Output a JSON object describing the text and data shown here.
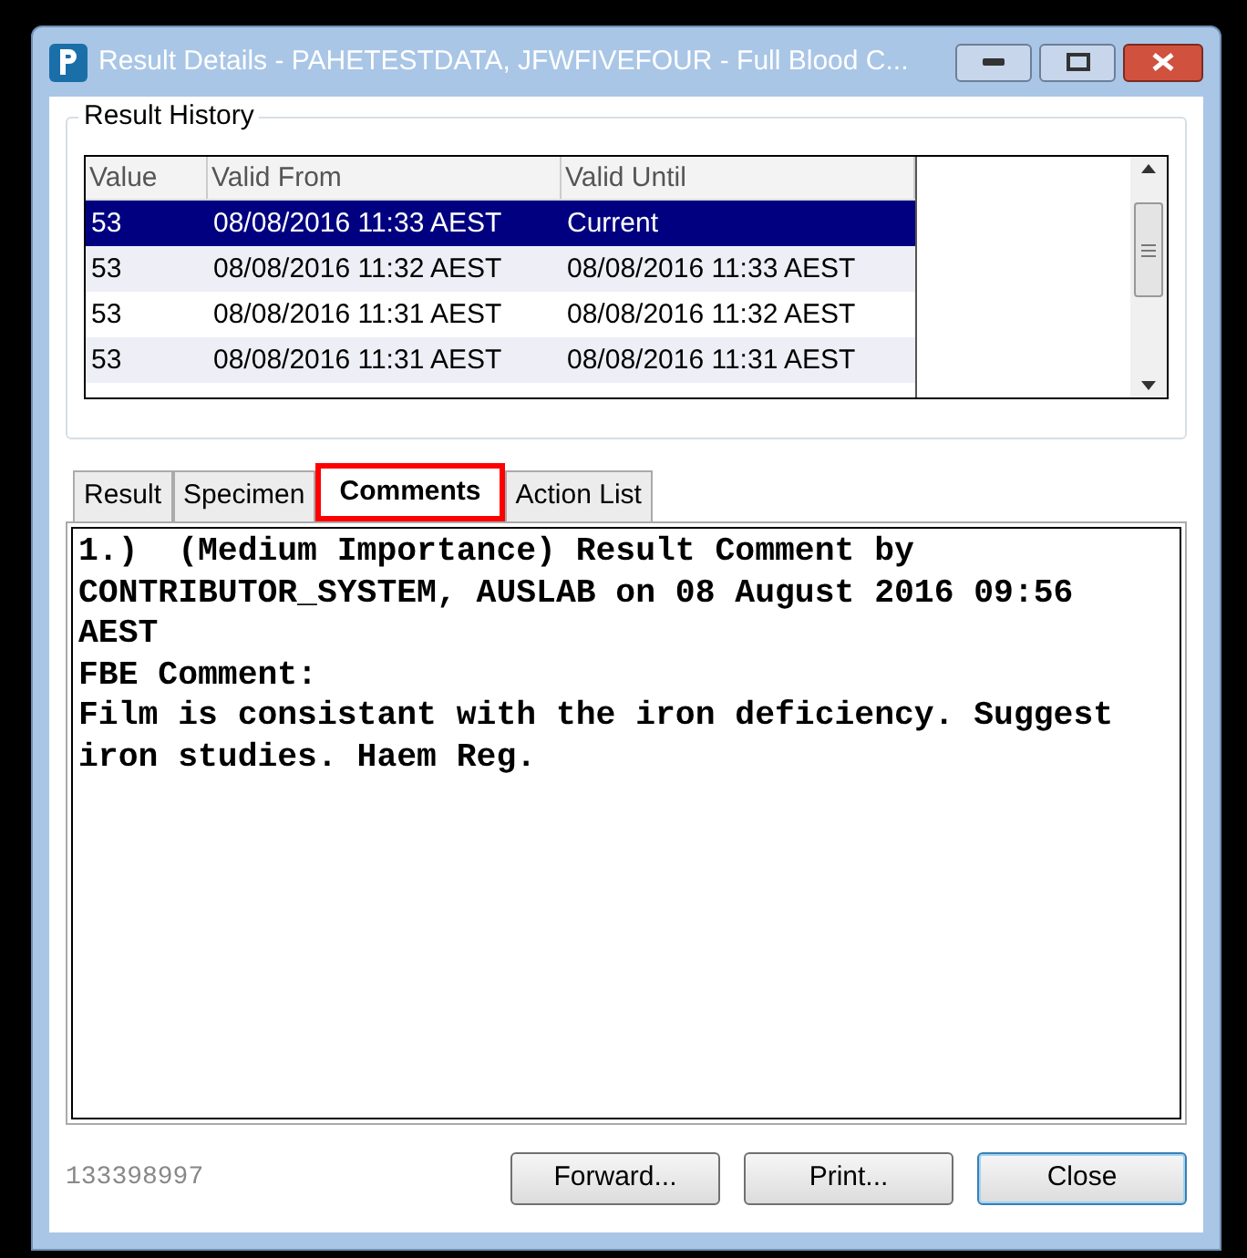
{
  "window": {
    "title": "Result Details - PAHETESTDATA, JFWFIVEFOUR - Full Blood C..."
  },
  "result_history": {
    "title": "Result History",
    "columns": [
      "Value",
      "Valid From",
      "Valid Until"
    ],
    "rows": [
      {
        "cells": [
          "53",
          "08/08/2016 11:33 AEST",
          "Current"
        ],
        "selected": true
      },
      {
        "cells": [
          "53",
          "08/08/2016 11:32 AEST",
          "08/08/2016 11:33 AEST"
        ],
        "selected": false
      },
      {
        "cells": [
          "53",
          "08/08/2016 11:31 AEST",
          "08/08/2016 11:32 AEST"
        ],
        "selected": false
      },
      {
        "cells": [
          "53",
          "08/08/2016 11:31 AEST",
          "08/08/2016 11:31 AEST"
        ],
        "selected": false
      }
    ]
  },
  "tabs": [
    {
      "label": "Result",
      "selected": false,
      "highlighted": false
    },
    {
      "label": "Specimen",
      "selected": false,
      "highlighted": false
    },
    {
      "label": "Comments",
      "selected": true,
      "highlighted": true
    },
    {
      "label": "Action List",
      "selected": false,
      "highlighted": false
    }
  ],
  "comments": [
    "1.)  (Medium Importance) Result Comment by",
    "CONTRIBUTOR_SYSTEM, AUSLAB on 08 August 2016 09:56",
    "AEST",
    "FBE Comment:",
    "Film is consistant with the iron deficiency. Suggest",
    "iron studies. Haem Reg."
  ],
  "footer": {
    "id": "133398997",
    "buttons": [
      {
        "label": "Forward...",
        "default": false
      },
      {
        "label": "Print...",
        "default": false
      },
      {
        "label": "Close",
        "default": true
      }
    ]
  }
}
